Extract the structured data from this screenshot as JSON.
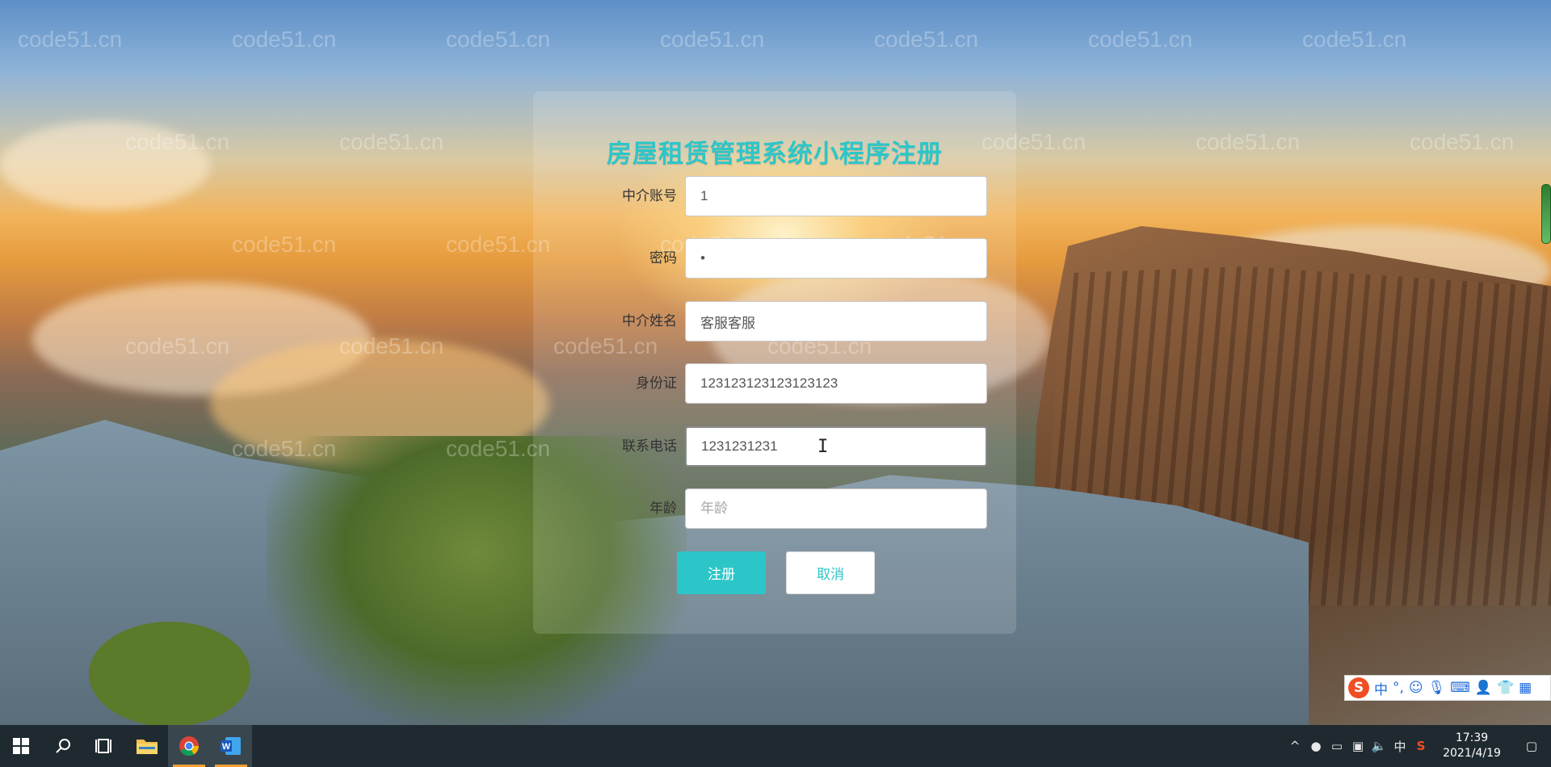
{
  "watermark": "code51.cn",
  "form": {
    "title": "房屋租赁管理系统小程序注册",
    "fields": [
      {
        "label": "中介账号",
        "value": "1",
        "placeholder": ""
      },
      {
        "label": "密码",
        "value": "•",
        "placeholder": ""
      },
      {
        "label": "中介姓名",
        "value": "客服客服",
        "placeholder": ""
      },
      {
        "label": "身份证",
        "value": "123123123123123123",
        "placeholder": ""
      },
      {
        "label": "联系电话",
        "value": "1231231231",
        "placeholder": ""
      },
      {
        "label": "年龄",
        "value": "",
        "placeholder": "年龄"
      }
    ],
    "submit_label": "注册",
    "cancel_label": "取消"
  },
  "ime": {
    "logo": "S",
    "mode": "中",
    "punct": "°,"
  },
  "taskbar": {
    "apps": [
      "start-icon",
      "search-icon",
      "task-view-icon",
      "file-explorer-icon",
      "chrome-icon",
      "word-icon"
    ],
    "tray_input": "中",
    "time": "17:39",
    "date": "2021/4/19"
  },
  "colors": {
    "accent": "#2cc6c9",
    "taskbar": "#1f2a30"
  }
}
